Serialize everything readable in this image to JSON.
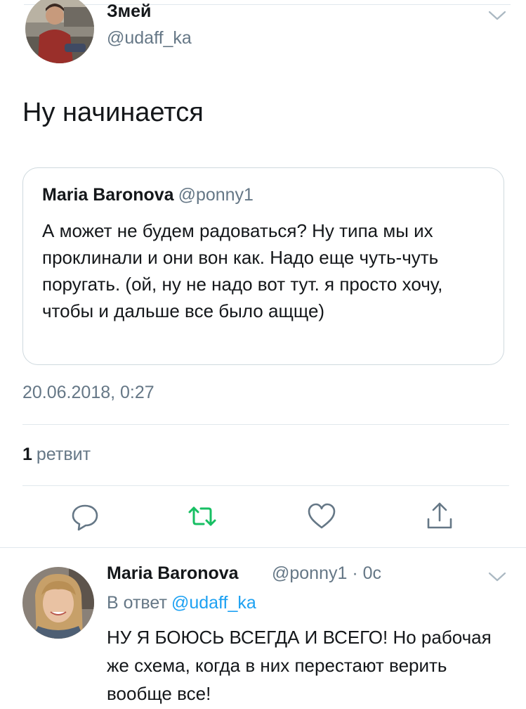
{
  "main_tweet": {
    "author_name": "Змей",
    "author_handle": "@udaff_ka",
    "text": "Ну начинается",
    "quoted_tweet": {
      "author_name": "Maria Baronova",
      "author_handle": "@ponny1",
      "text": "А может не будем радоваться? Ну типа мы их проклинали и они вон как. Надо еще чуть-чуть поругать. (ой, ну не надо вот тут. я просто хочу, чтобы и дальше все было ащще)"
    },
    "timestamp": "20.06.2018, 0:27",
    "stats": {
      "retweet_count": "1",
      "retweet_label": "ретвит"
    },
    "actions": [
      "reply-icon",
      "retweet-icon",
      "like-icon",
      "share-icon"
    ]
  },
  "reply_tweet": {
    "author_name": "Maria Baronova",
    "author_handle": "@ponny1 · 0с",
    "reply_to_label": "В ответ",
    "reply_to_handle": "@udaff_ka",
    "text": "НУ Я БОЮСЬ ВСЕГДА И ВСЕГО! Но рабочая же схема, когда в них перестают верить вообще все!"
  },
  "colors": {
    "text": "#14171a",
    "secondary": "#657786",
    "accent": "#1da1f2",
    "retweet_active": "#17bf63",
    "border": "#e1e8ed"
  }
}
